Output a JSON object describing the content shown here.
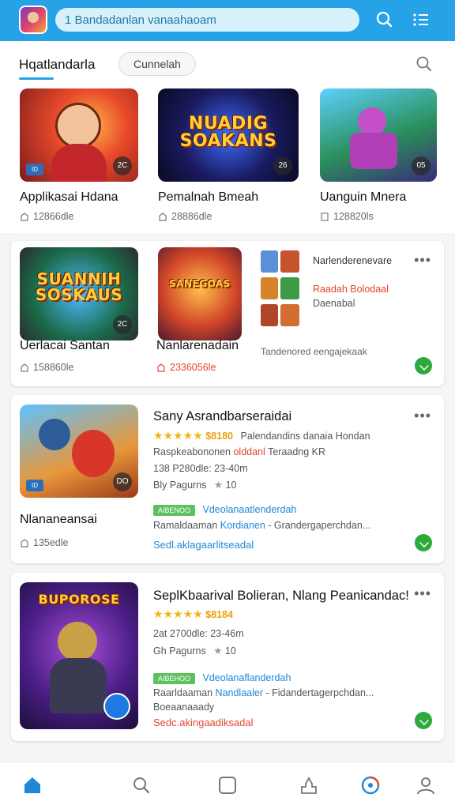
{
  "topbar": {
    "search_text": "1 Bandadanlan vanaahaoam",
    "search_placeholder": "1 Bandadanlan vanaahaoam"
  },
  "subhead": {
    "title": "Hqatlandarla",
    "chip": "Cunnelah"
  },
  "featured": [
    {
      "name": "Applikasai Hdana",
      "meta": "12866dle",
      "badge_l": "ID",
      "badge_r": "2C",
      "thumb_text": ""
    },
    {
      "name": "Pemalnah Bmeah",
      "meta": "28886dle",
      "badge_l": "",
      "badge_r": "26",
      "thumb_text": "NUADIG SOAKANS"
    },
    {
      "name": "Uanguin Mnera",
      "meta": "128820ls",
      "badge_l": "",
      "badge_r": "05",
      "thumb_text": ""
    }
  ],
  "card1": {
    "items": [
      {
        "name": "Uerlacai Santan",
        "meta": "158860le",
        "badge_l": "",
        "badge_r": "2C",
        "thumb_text": "SUANNIH SOSKAUS"
      },
      {
        "name": "Nanlarenadain",
        "meta": "2336056le",
        "badge_l": "",
        "badge_r": "",
        "thumb_text": "SANEGOAS"
      }
    ],
    "side_title": "Narlenderenevare",
    "side_line1": "Raadah Bolodaal",
    "side_line2": "Daenabal",
    "footer": "Tandenored eengajekaak"
  },
  "card2": {
    "name": "Nlananeansai",
    "meta": "135edle",
    "badge_l": "ID",
    "badge_r": "DO",
    "title": "Sany Asrandbarseraidai",
    "stars": "★★★★★",
    "price": "$8180",
    "line1_rest": "Palendandins danaia Hondan",
    "line2": "Raspkeabononen",
    "line2_highlight": "olddanl",
    "line2_rest": "Teraadng KR",
    "line3": "138 P280dle: 23-40m",
    "line4": "Bly Pagurns",
    "line4_rating": "10",
    "tag": "AIBENOO",
    "tag_text": "Vdeolanaatlenderdah",
    "line6": "Ramaldaaman",
    "line6_blue": "Kordianen",
    "line6_rest": "- Grandergaperchdan...",
    "link": "Sedl.aklagaarlitseadal"
  },
  "card3": {
    "title": "SeplKbaarival Bolieran, Nlang Peanicandac!",
    "stars": "★★★★★",
    "price": "$8184",
    "line3": "2at 2700dle: 23-46m",
    "line4": "Gh Pagurns",
    "line4_rating": "10",
    "tag": "AIBEHOO",
    "tag_text": "Vdeolanaflanderdah",
    "line6": "Raarldaaman",
    "line6_blue": "Nandlaaler",
    "line6_rest": "- Fidandertagerpchdan...",
    "line7": "Boeaanaaady",
    "link": "Sedc.akingaadiksadal",
    "thumb_text": "BUPOROSE"
  },
  "colors": {
    "accent": "#26a3e6",
    "download": "#2eaa3c",
    "star": "#f3b414"
  }
}
